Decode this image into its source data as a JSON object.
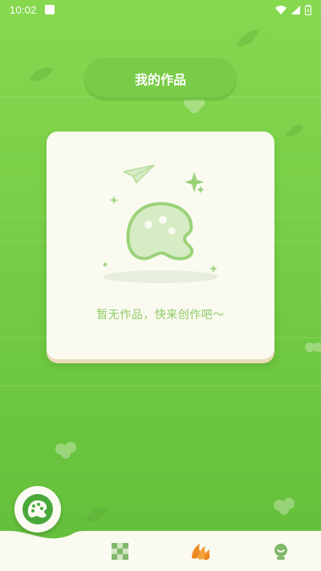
{
  "status_bar": {
    "time": "10:02"
  },
  "header": {
    "title": "我的作品"
  },
  "empty_state": {
    "message": "暂无作品，快来创作吧～"
  },
  "fab": {
    "icon": "palette-icon"
  },
  "bottom_nav": {
    "items": [
      {
        "icon": "checker-grid-icon",
        "active": false
      },
      {
        "icon": "flame-book-icon",
        "active": true
      },
      {
        "icon": "profile-icon",
        "active": false
      }
    ]
  },
  "colors": {
    "background": "#7ad048",
    "card": "#fafaf0",
    "accent_text": "#8fcb66",
    "active_nav": "#f08a24"
  }
}
